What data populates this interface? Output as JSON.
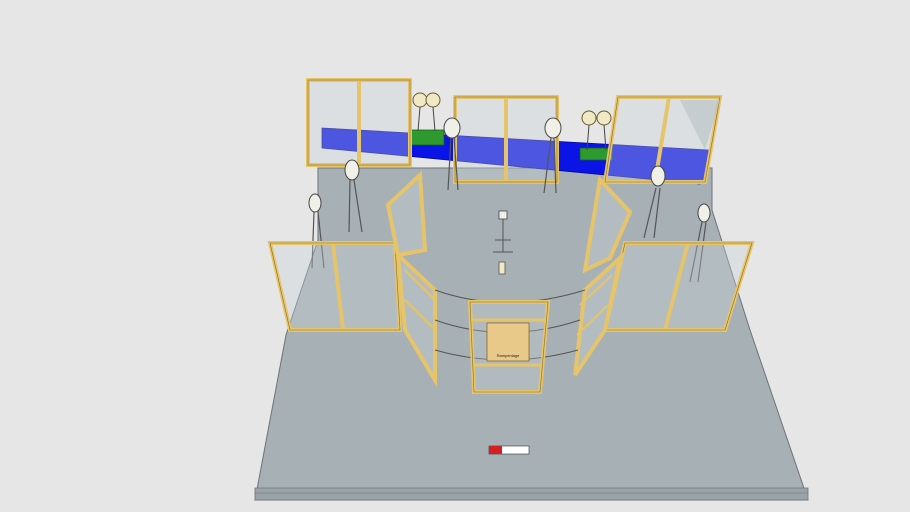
{
  "scene": {
    "background": "#e6e6e6",
    "floor_color": "#a7b1b5",
    "floor_edge_color": "#6b7378",
    "tarp_color": "#0a14e6",
    "wood_color": "#e6c46a",
    "wood_edge_color": "#8a6a20",
    "glass_color": "#c9d2d6",
    "bench_color": "#2e9a2e",
    "sign_color": "#e8c98a",
    "marker_color": "#d42020"
  },
  "sign": {
    "label": "Rampenlage"
  }
}
